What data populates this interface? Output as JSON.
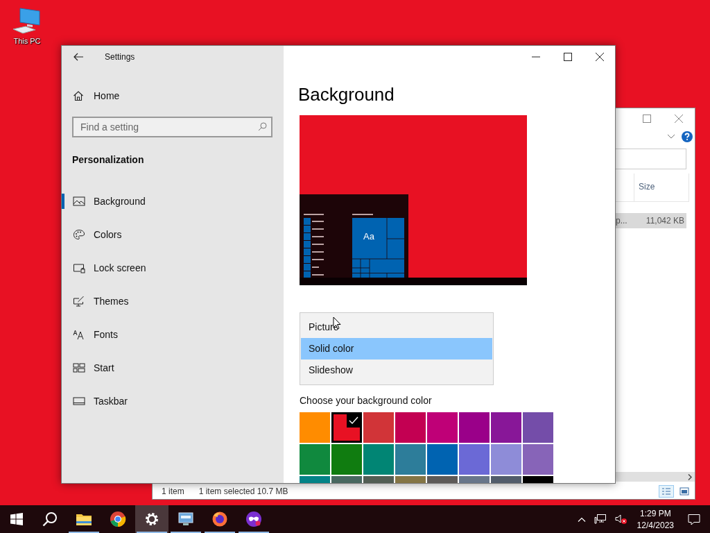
{
  "desktop": {
    "icons": [
      {
        "label": "This PC"
      }
    ]
  },
  "explorer": {
    "column_header": "Size",
    "row": {
      "name": "p...",
      "size": "11,042 KB",
      "selected": true
    },
    "status": [
      "1 item",
      "1 item selected 10.7 MB"
    ],
    "views": [
      {
        "kind": "details",
        "selected": true
      },
      {
        "kind": "tiles",
        "selected": false
      }
    ]
  },
  "settings": {
    "title": "Settings",
    "home": "Home",
    "search": {
      "placeholder": "Find a setting"
    },
    "section": "Personalization",
    "nav": [
      {
        "label": "Background",
        "kind": "picture",
        "selected": true
      },
      {
        "label": "Colors",
        "kind": "palette",
        "selected": false
      },
      {
        "label": "Lock screen",
        "kind": "lock",
        "selected": false
      },
      {
        "label": "Themes",
        "kind": "brush",
        "selected": false
      },
      {
        "label": "Fonts",
        "kind": "fonts",
        "selected": false
      },
      {
        "label": "Start",
        "kind": "start",
        "selected": false
      },
      {
        "label": "Taskbar",
        "kind": "taskbar",
        "selected": false
      }
    ],
    "page_title": "Background",
    "preview": {
      "tile_label": "Aa"
    },
    "dropdown": {
      "options": [
        {
          "label": "Picture",
          "selected": false
        },
        {
          "label": "Solid color",
          "selected": true
        },
        {
          "label": "Slideshow",
          "selected": false
        }
      ]
    },
    "color_label": "Choose your background color",
    "colors": [
      {
        "color": "#ff8c00",
        "selected": false
      },
      {
        "color": "#e81123",
        "selected": true
      },
      {
        "color": "#d13438",
        "selected": false
      },
      {
        "color": "#c30052",
        "selected": false
      },
      {
        "color": "#bf0077",
        "selected": false
      },
      {
        "color": "#9a0089",
        "selected": false
      },
      {
        "color": "#881798",
        "selected": false
      },
      {
        "color": "#744da9",
        "selected": false
      },
      {
        "color": "#10893e",
        "selected": false
      },
      {
        "color": "#107c10",
        "selected": false
      },
      {
        "color": "#018574",
        "selected": false
      },
      {
        "color": "#2d7d9a",
        "selected": false
      },
      {
        "color": "#0063b1",
        "selected": false
      },
      {
        "color": "#6b69d6",
        "selected": false
      },
      {
        "color": "#8e8cd8",
        "selected": false
      },
      {
        "color": "#8764b8",
        "selected": false
      },
      {
        "color": "#038387",
        "selected": false
      },
      {
        "color": "#486860",
        "selected": false
      },
      {
        "color": "#525e54",
        "selected": false
      },
      {
        "color": "#847545",
        "selected": false
      },
      {
        "color": "#5d5a58",
        "selected": false
      },
      {
        "color": "#68768a",
        "selected": false
      },
      {
        "color": "#515c6b",
        "selected": false
      },
      {
        "color": "#000000",
        "selected": false
      }
    ]
  },
  "taskbar": {
    "apps": [
      {
        "kind": "folder",
        "running": true,
        "active": false
      },
      {
        "kind": "chrome",
        "running": false,
        "active": false
      },
      {
        "kind": "gear",
        "running": true,
        "active": true
      },
      {
        "kind": "remote",
        "running": true,
        "active": false
      },
      {
        "kind": "firefox",
        "running": true,
        "active": false
      },
      {
        "kind": "mask",
        "running": true,
        "active": false
      }
    ],
    "clock": {
      "time": "1:29 PM",
      "date": "12/4/2023"
    }
  }
}
